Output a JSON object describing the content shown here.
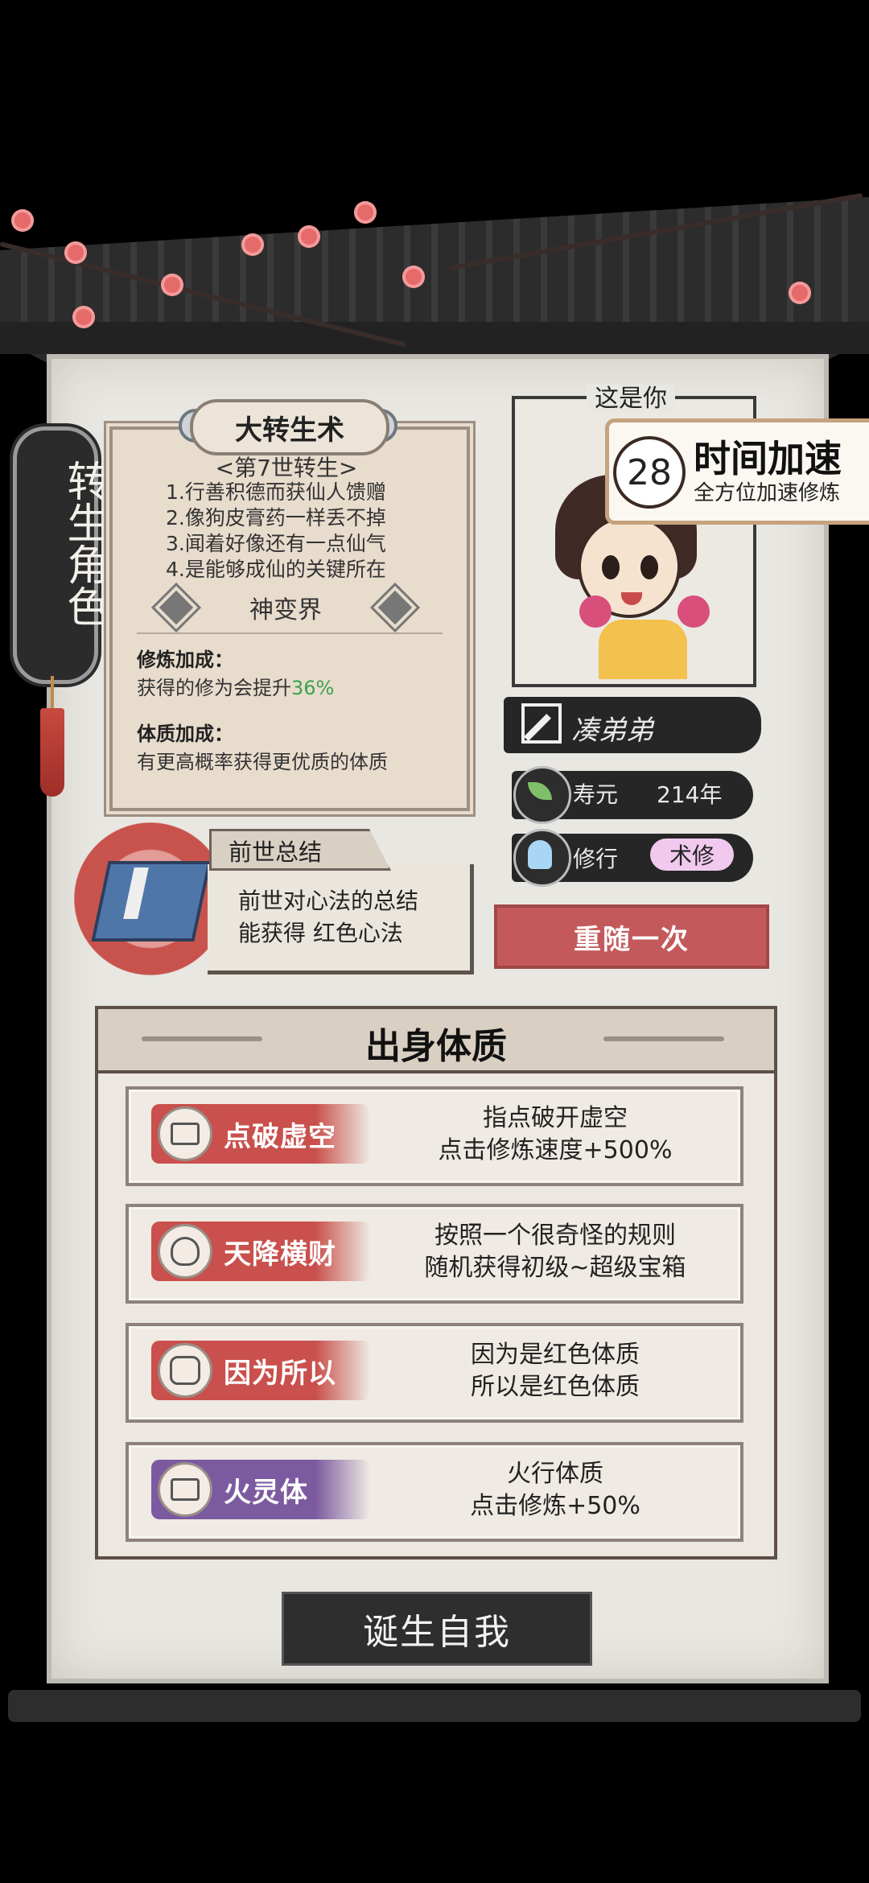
{
  "side_tag": {
    "label": "转生角色"
  },
  "technique": {
    "title": "大转生术",
    "subtitle": "<第7世转生>",
    "lines": [
      "1.行善积德而获仙人馈赠",
      "2.像狗皮膏药一样丢不掉",
      "3.闻着好像还有一点仙气",
      "4.是能够成仙的关键所在"
    ],
    "realm": "神变界",
    "cultivation_bonus": {
      "heading": "修炼加成：",
      "text": "获得的修为会提升",
      "value": "36%",
      "value_color": "#3aa34a"
    },
    "physique_bonus": {
      "heading": "体质加成：",
      "text": "有更高概率获得更优质的体质"
    }
  },
  "previous_life": {
    "title": "前世总结",
    "line1": "前世对心法的总结",
    "line2": "能获得 红色心法"
  },
  "portrait": {
    "label": "这是你"
  },
  "speed_up": {
    "count": "28",
    "title": "时间加速",
    "subtitle": "全方位加速修炼"
  },
  "character": {
    "name": "凑弟弟",
    "lifespan_label": "寿元",
    "lifespan_value": "214年",
    "path_label": "修行",
    "path_value": "术修"
  },
  "reroll_button": "重随一次",
  "constitution": {
    "title": "出身体质",
    "items": [
      {
        "name": "点破虚空",
        "icon": "scroll-icon",
        "color": "#c9504c",
        "desc1": "指点破开虚空",
        "desc2": "点击修炼速度+500%"
      },
      {
        "name": "天降横财",
        "icon": "money-bag-icon",
        "color": "#c9504c",
        "desc1": "按照一个很奇怪的规则",
        "desc2": "随机获得初级~超级宝箱"
      },
      {
        "name": "因为所以",
        "icon": "fist-icon",
        "color": "#c9504c",
        "desc1": "因为是红色体质",
        "desc2": "所以是红色体质"
      },
      {
        "name": "火灵体",
        "icon": "scroll-icon",
        "color": "#7c5aa0",
        "desc1": "火行体质",
        "desc2": "点击修炼+50%"
      }
    ]
  },
  "birth_button": "诞生自我"
}
